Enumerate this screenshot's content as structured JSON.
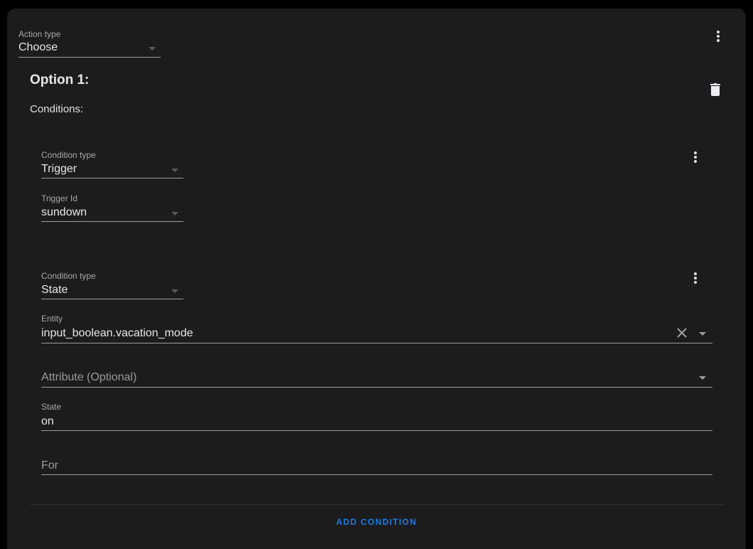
{
  "action": {
    "type_label": "Action type",
    "type_value": "Choose",
    "menu_icon": "dots-vertical-icon"
  },
  "option": {
    "title": "Option 1:",
    "conditions_label": "Conditions:",
    "delete_icon": "trash-icon"
  },
  "conditions": [
    {
      "type_label": "Condition type",
      "type_value": "Trigger",
      "trigger_id_label": "Trigger Id",
      "trigger_id_value": "sundown"
    },
    {
      "type_label": "Condition type",
      "type_value": "State",
      "entity_label": "Entity",
      "entity_value": "input_boolean.vacation_mode",
      "attribute_placeholder": "Attribute (Optional)",
      "state_label": "State",
      "state_value": "on",
      "for_placeholder": "For"
    }
  ],
  "add_condition_label": "ADD CONDITION",
  "colors": {
    "accent": "#1f7ce0",
    "card_bg": "#1c1c1e",
    "page_bg": "#000000"
  }
}
